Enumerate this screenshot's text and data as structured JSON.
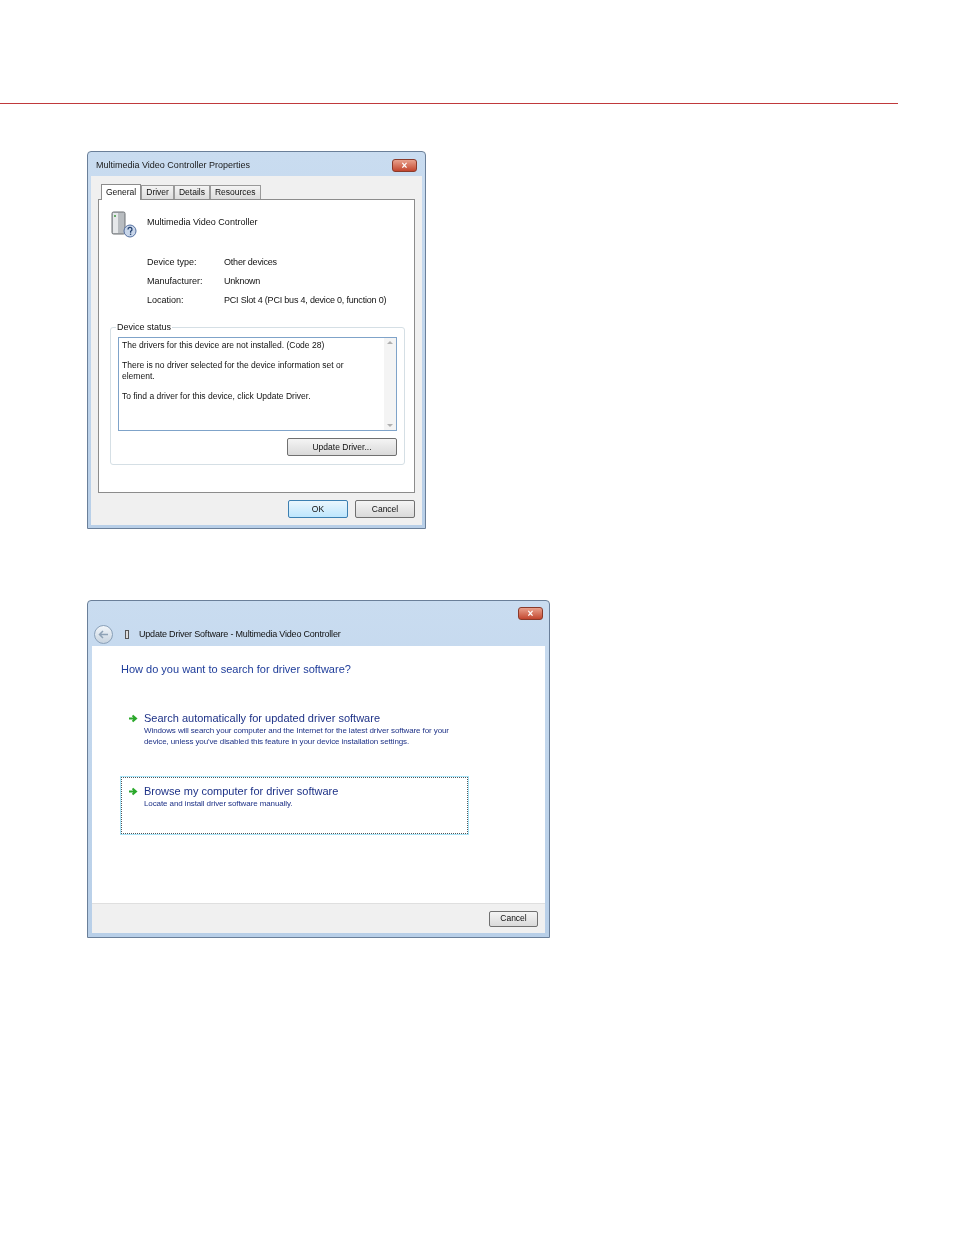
{
  "properties_dialog": {
    "title": "Multimedia Video Controller Properties",
    "close": "×",
    "tabs": [
      {
        "label": "General",
        "selected": true
      },
      {
        "label": "Driver",
        "selected": false
      },
      {
        "label": "Details",
        "selected": false
      },
      {
        "label": "Resources",
        "selected": false
      }
    ],
    "device_name": "Multimedia Video Controller",
    "fields": [
      {
        "label": "Device type:",
        "value": "Other devices"
      },
      {
        "label": "Manufacturer:",
        "value": "Unknown"
      },
      {
        "label": "Location:",
        "value": "PCI Slot 4 (PCI bus 4, device 0, function 0)"
      }
    ],
    "status_group": "Device status",
    "status_text": [
      "The drivers for this device are not installed. (Code 28)",
      "There is no driver selected for the device information set or element.",
      "To find a driver for this device, click Update Driver."
    ],
    "update_button": "Update Driver...",
    "buttons": [
      {
        "label": "OK",
        "default": true
      },
      {
        "label": "Cancel",
        "default": false
      }
    ]
  },
  "update_dialog": {
    "title": "Update Driver Software - Multimedia Video Controller",
    "close": "×",
    "heading": "How do you want to search for driver software?",
    "options": [
      {
        "title": "Search automatically for updated driver software",
        "description": "Windows will search your computer and the Internet for the latest driver software for your device, unless you've disabled this feature in your device installation settings.",
        "focused": false
      },
      {
        "title": "Browse my computer for driver software",
        "description": "Locate and install driver software manually.",
        "focused": true
      }
    ],
    "cancel": "Cancel"
  }
}
